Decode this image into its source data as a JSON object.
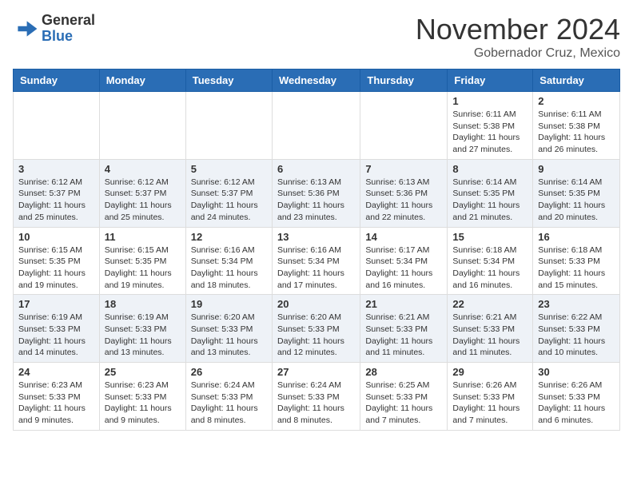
{
  "header": {
    "logo_general": "General",
    "logo_blue": "Blue",
    "month": "November 2024",
    "location": "Gobernador Cruz, Mexico"
  },
  "weekdays": [
    "Sunday",
    "Monday",
    "Tuesday",
    "Wednesday",
    "Thursday",
    "Friday",
    "Saturday"
  ],
  "weeks": [
    [
      {
        "day": "",
        "info": ""
      },
      {
        "day": "",
        "info": ""
      },
      {
        "day": "",
        "info": ""
      },
      {
        "day": "",
        "info": ""
      },
      {
        "day": "",
        "info": ""
      },
      {
        "day": "1",
        "info": "Sunrise: 6:11 AM\nSunset: 5:38 PM\nDaylight: 11 hours and 27 minutes."
      },
      {
        "day": "2",
        "info": "Sunrise: 6:11 AM\nSunset: 5:38 PM\nDaylight: 11 hours and 26 minutes."
      }
    ],
    [
      {
        "day": "3",
        "info": "Sunrise: 6:12 AM\nSunset: 5:37 PM\nDaylight: 11 hours and 25 minutes."
      },
      {
        "day": "4",
        "info": "Sunrise: 6:12 AM\nSunset: 5:37 PM\nDaylight: 11 hours and 25 minutes."
      },
      {
        "day": "5",
        "info": "Sunrise: 6:12 AM\nSunset: 5:37 PM\nDaylight: 11 hours and 24 minutes."
      },
      {
        "day": "6",
        "info": "Sunrise: 6:13 AM\nSunset: 5:36 PM\nDaylight: 11 hours and 23 minutes."
      },
      {
        "day": "7",
        "info": "Sunrise: 6:13 AM\nSunset: 5:36 PM\nDaylight: 11 hours and 22 minutes."
      },
      {
        "day": "8",
        "info": "Sunrise: 6:14 AM\nSunset: 5:35 PM\nDaylight: 11 hours and 21 minutes."
      },
      {
        "day": "9",
        "info": "Sunrise: 6:14 AM\nSunset: 5:35 PM\nDaylight: 11 hours and 20 minutes."
      }
    ],
    [
      {
        "day": "10",
        "info": "Sunrise: 6:15 AM\nSunset: 5:35 PM\nDaylight: 11 hours and 19 minutes."
      },
      {
        "day": "11",
        "info": "Sunrise: 6:15 AM\nSunset: 5:35 PM\nDaylight: 11 hours and 19 minutes."
      },
      {
        "day": "12",
        "info": "Sunrise: 6:16 AM\nSunset: 5:34 PM\nDaylight: 11 hours and 18 minutes."
      },
      {
        "day": "13",
        "info": "Sunrise: 6:16 AM\nSunset: 5:34 PM\nDaylight: 11 hours and 17 minutes."
      },
      {
        "day": "14",
        "info": "Sunrise: 6:17 AM\nSunset: 5:34 PM\nDaylight: 11 hours and 16 minutes."
      },
      {
        "day": "15",
        "info": "Sunrise: 6:18 AM\nSunset: 5:34 PM\nDaylight: 11 hours and 16 minutes."
      },
      {
        "day": "16",
        "info": "Sunrise: 6:18 AM\nSunset: 5:33 PM\nDaylight: 11 hours and 15 minutes."
      }
    ],
    [
      {
        "day": "17",
        "info": "Sunrise: 6:19 AM\nSunset: 5:33 PM\nDaylight: 11 hours and 14 minutes."
      },
      {
        "day": "18",
        "info": "Sunrise: 6:19 AM\nSunset: 5:33 PM\nDaylight: 11 hours and 13 minutes."
      },
      {
        "day": "19",
        "info": "Sunrise: 6:20 AM\nSunset: 5:33 PM\nDaylight: 11 hours and 13 minutes."
      },
      {
        "day": "20",
        "info": "Sunrise: 6:20 AM\nSunset: 5:33 PM\nDaylight: 11 hours and 12 minutes."
      },
      {
        "day": "21",
        "info": "Sunrise: 6:21 AM\nSunset: 5:33 PM\nDaylight: 11 hours and 11 minutes."
      },
      {
        "day": "22",
        "info": "Sunrise: 6:21 AM\nSunset: 5:33 PM\nDaylight: 11 hours and 11 minutes."
      },
      {
        "day": "23",
        "info": "Sunrise: 6:22 AM\nSunset: 5:33 PM\nDaylight: 11 hours and 10 minutes."
      }
    ],
    [
      {
        "day": "24",
        "info": "Sunrise: 6:23 AM\nSunset: 5:33 PM\nDaylight: 11 hours and 9 minutes."
      },
      {
        "day": "25",
        "info": "Sunrise: 6:23 AM\nSunset: 5:33 PM\nDaylight: 11 hours and 9 minutes."
      },
      {
        "day": "26",
        "info": "Sunrise: 6:24 AM\nSunset: 5:33 PM\nDaylight: 11 hours and 8 minutes."
      },
      {
        "day": "27",
        "info": "Sunrise: 6:24 AM\nSunset: 5:33 PM\nDaylight: 11 hours and 8 minutes."
      },
      {
        "day": "28",
        "info": "Sunrise: 6:25 AM\nSunset: 5:33 PM\nDaylight: 11 hours and 7 minutes."
      },
      {
        "day": "29",
        "info": "Sunrise: 6:26 AM\nSunset: 5:33 PM\nDaylight: 11 hours and 7 minutes."
      },
      {
        "day": "30",
        "info": "Sunrise: 6:26 AM\nSunset: 5:33 PM\nDaylight: 11 hours and 6 minutes."
      }
    ]
  ]
}
